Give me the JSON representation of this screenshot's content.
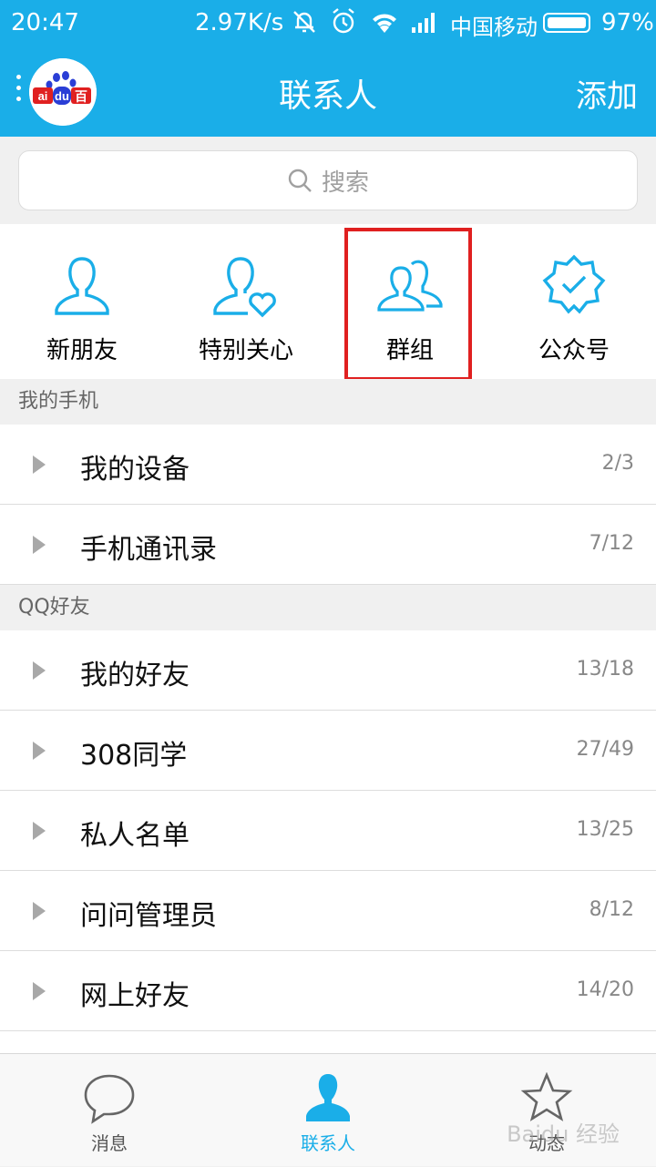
{
  "status_bar": {
    "time": "20:47",
    "speed": "2.97K/s",
    "carrier": "中国移动",
    "battery": "97%"
  },
  "header": {
    "title": "联系人",
    "add_label": "添加",
    "avatar_text": "ai du 百"
  },
  "search": {
    "placeholder": "搜索"
  },
  "quick_actions": [
    {
      "label": "新朋友",
      "icon": "person-icon"
    },
    {
      "label": "特别关心",
      "icon": "person-heart-icon"
    },
    {
      "label": "群组",
      "icon": "group-icon"
    },
    {
      "label": "公众号",
      "icon": "badge-check-icon"
    }
  ],
  "sections": [
    {
      "title": "我的手机",
      "items": [
        {
          "label": "我的设备",
          "count": "2/3"
        },
        {
          "label": "手机通讯录",
          "count": "7/12"
        }
      ]
    },
    {
      "title": "QQ好友",
      "items": [
        {
          "label": "我的好友",
          "count": "13/18"
        },
        {
          "label": "308同学",
          "count": "27/49"
        },
        {
          "label": "私人名单",
          "count": "13/25"
        },
        {
          "label": "问问管理员",
          "count": "8/12"
        },
        {
          "label": "网上好友",
          "count": "14/20"
        }
      ]
    }
  ],
  "tabs": [
    {
      "label": "消息",
      "icon": "chat-bubble-icon"
    },
    {
      "label": "联系人",
      "icon": "person-icon"
    },
    {
      "label": "动态",
      "icon": "star-icon"
    }
  ],
  "watermark": "Baidu 经验",
  "colors": {
    "accent": "#1aaee8",
    "highlight": "#e02020"
  }
}
